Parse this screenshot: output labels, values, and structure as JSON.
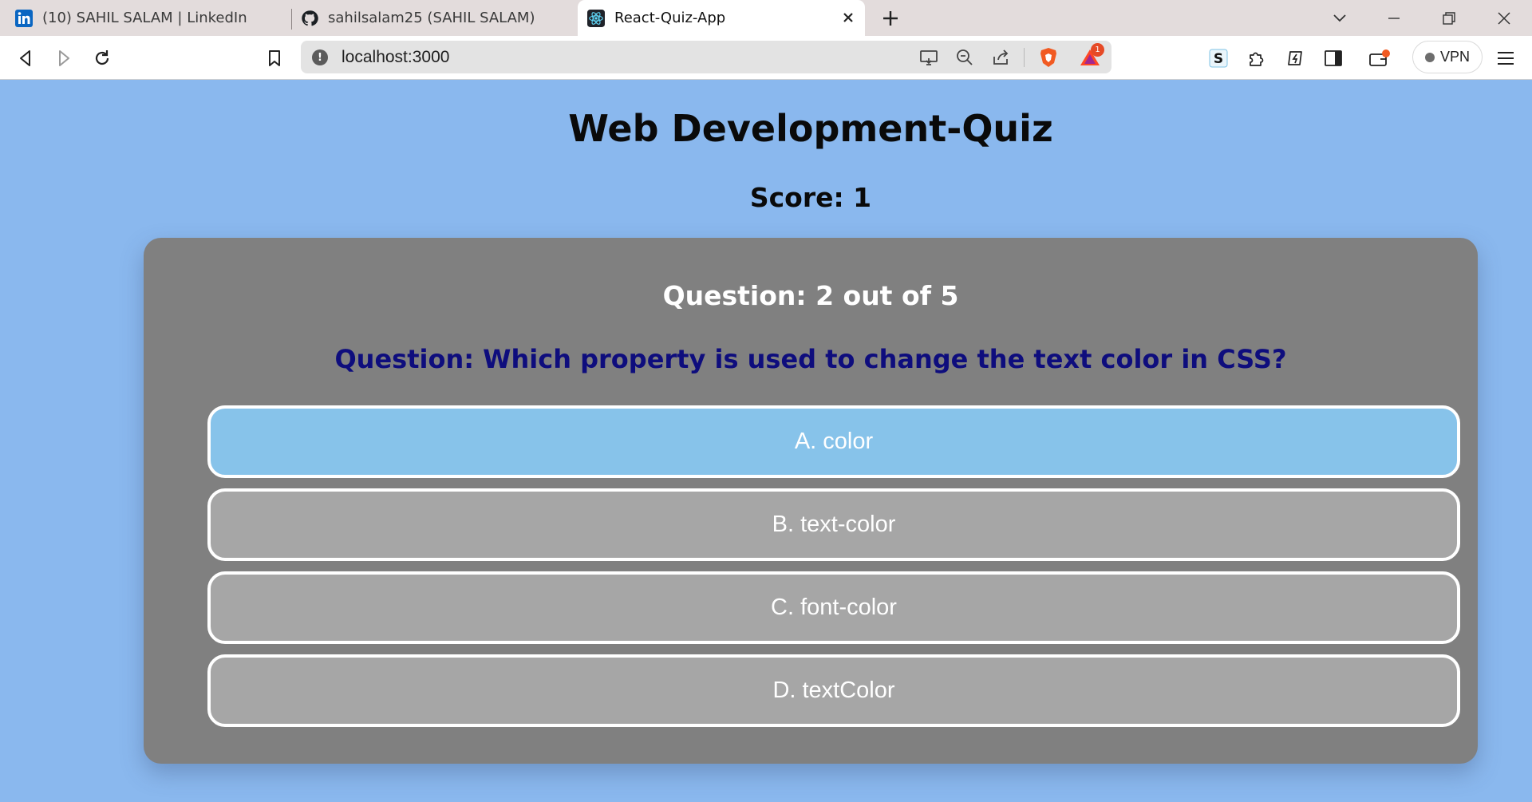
{
  "browser": {
    "tabs": [
      {
        "title": "(10) SAHIL SALAM | LinkedIn",
        "icon": "linkedin-icon",
        "active": false
      },
      {
        "title": "sahilsalam25 (SAHIL SALAM)",
        "icon": "github-icon",
        "active": false
      },
      {
        "title": "React-Quiz-App",
        "icon": "react-icon",
        "active": true
      }
    ],
    "address": "localhost:3000",
    "notification_count": "1",
    "vpn_label": "VPN",
    "colors": {
      "accent_shields": "#f15a22",
      "badge": "#e64a26"
    }
  },
  "quiz": {
    "title": "Web Development-Quiz",
    "score_text": "Score: 1",
    "progress_text": "Question: 2 out of 5",
    "question_text": "Question: Which property is used to change the text color in CSS?",
    "options": [
      {
        "label": "A. color",
        "selected": true
      },
      {
        "label": "B. text-color",
        "selected": false
      },
      {
        "label": "C. font-color",
        "selected": false
      },
      {
        "label": "D. textColor",
        "selected": false
      }
    ],
    "colors": {
      "page_bg": "#8ab8ee",
      "card_bg": "#808080",
      "option_bg": "#a6a6a6",
      "option_selected_bg": "#87c3ea",
      "question_text": "#0e0d7d"
    }
  }
}
